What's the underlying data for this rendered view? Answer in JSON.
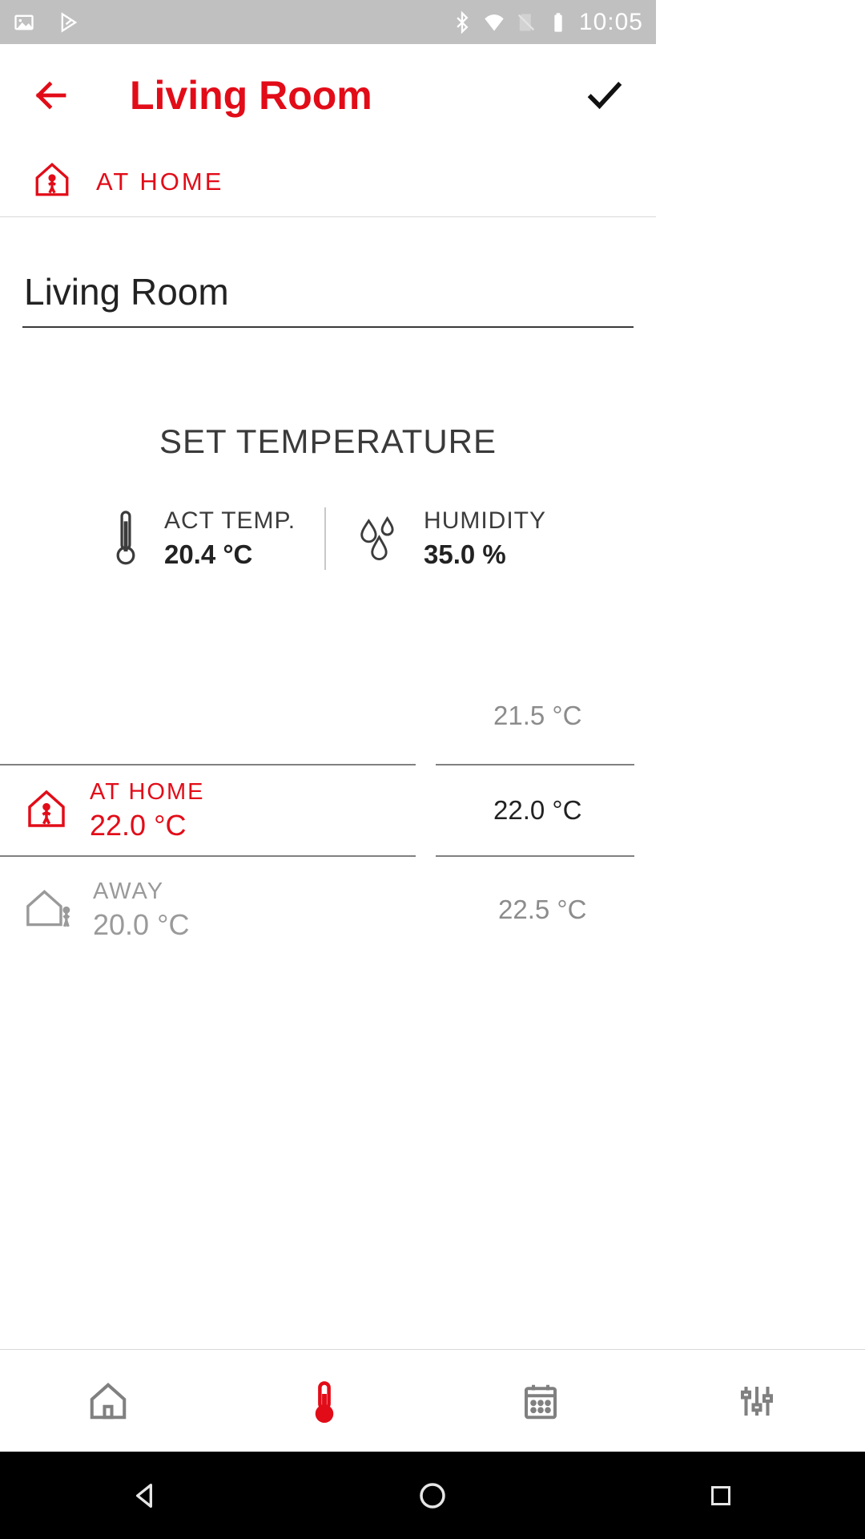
{
  "status": {
    "time": "10:05"
  },
  "header": {
    "title": "Living Room"
  },
  "mode": {
    "label": "AT HOME"
  },
  "room_name": {
    "value": "Living Room"
  },
  "section": {
    "title": "SET TEMPERATURE"
  },
  "readings": {
    "temp": {
      "label": "ACT TEMP.",
      "value": "20.4 °C"
    },
    "humidity": {
      "label": "HUMIDITY",
      "value": "35.0 %"
    }
  },
  "mode_wheel": {
    "items": [
      {
        "label": "AT HOME",
        "value": "22.0 °C"
      },
      {
        "label": "AWAY",
        "value": "20.0 °C"
      }
    ]
  },
  "temp_wheel": {
    "above": "21.5 °C",
    "center": "22.0 °C",
    "below": "22.5 °C"
  },
  "colors": {
    "accent": "#e20c18"
  }
}
